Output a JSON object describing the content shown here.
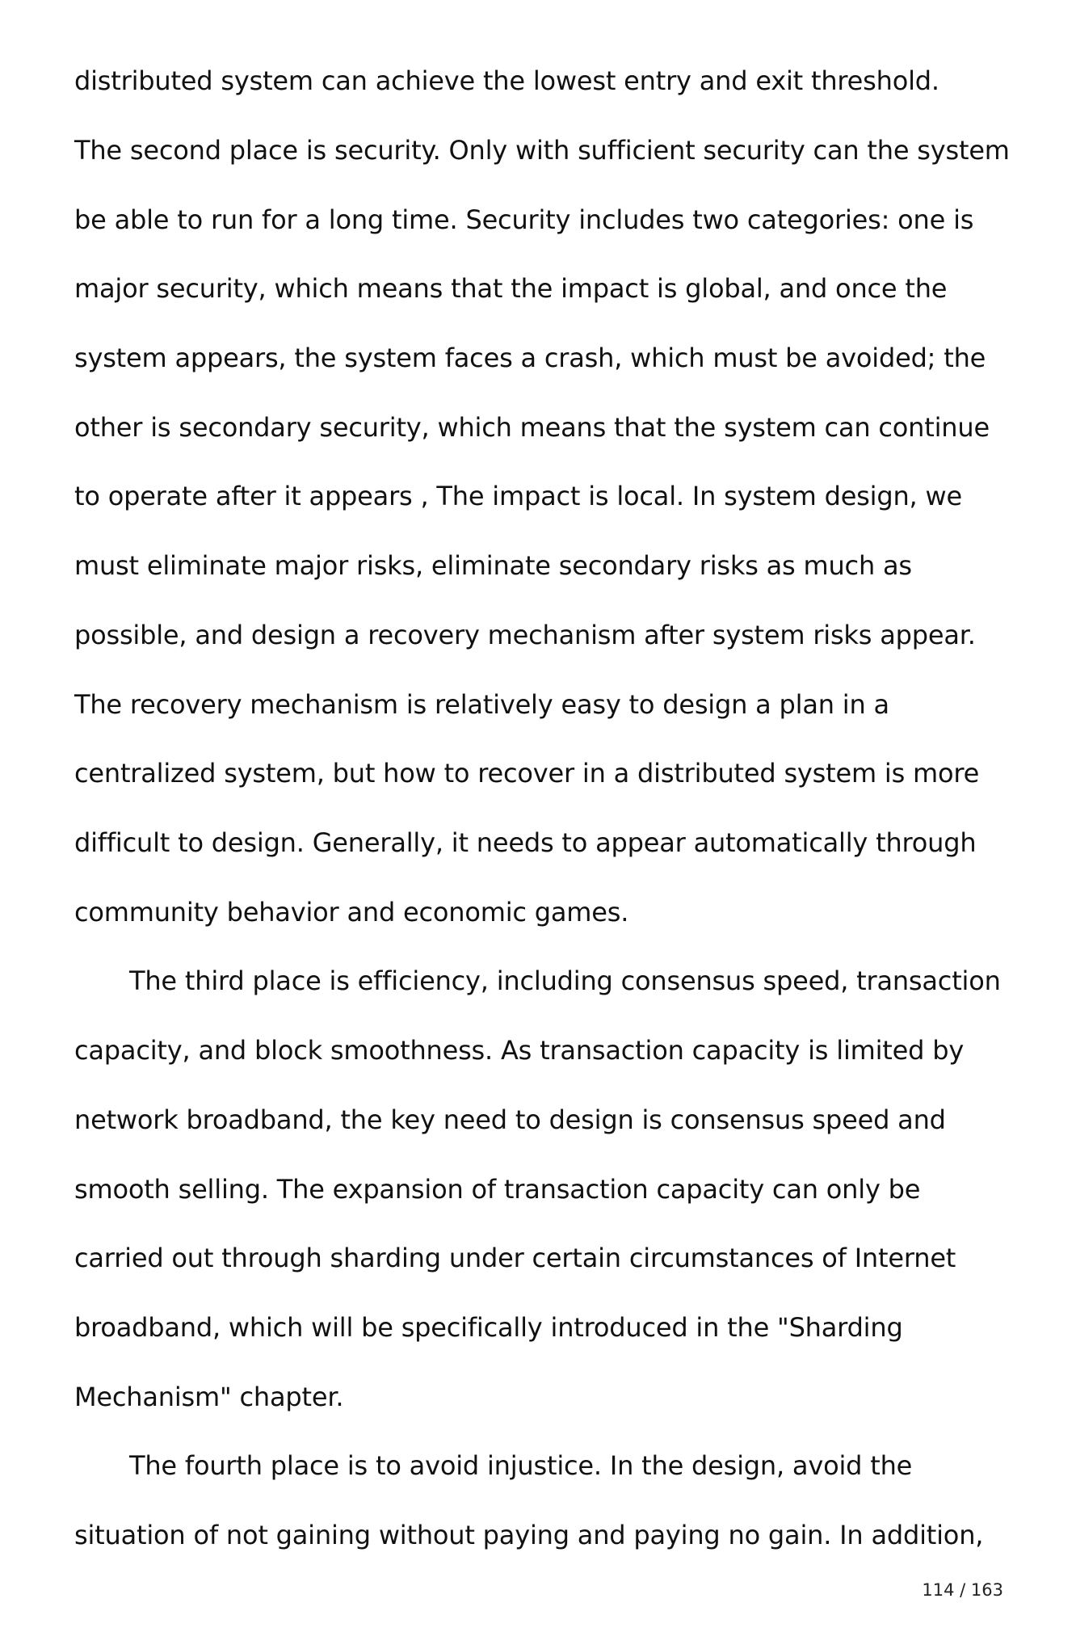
{
  "document": {
    "lines": [
      "distributed system can achieve the lowest entry and exit threshold.",
      "The second place is security. Only with sufficient security can the system",
      "be able to run for a long time. Security includes two categories: one is",
      "major security, which means that the impact is global, and once the",
      "system appears, the system faces a crash, which must be avoided; the",
      "other is secondary security, which means that the system can continue",
      "to operate after it appears , The impact is local. In system design, we",
      "must eliminate major risks, eliminate secondary risks as much as",
      "possible, and design a recovery mechanism after system risks appear.",
      "The recovery mechanism is relatively easy to design a plan in a",
      "centralized system, but how to recover in a distributed system is more",
      "difficult to design. Generally, it needs to appear automatically through",
      "community behavior and economic games.",
      "The third place is efficiency, including consensus speed, transaction",
      "capacity, and block smoothness. As transaction capacity is limited by",
      "network broadband, the key need to design is consensus speed and",
      "smooth selling. The expansion of transaction capacity can only be",
      "carried out through sharding under certain circumstances of Internet",
      "broadband, which will be specifically introduced in the \"Sharding",
      "Mechanism\" chapter.",
      "The fourth place is to avoid injustice. In the design, avoid the",
      "situation of not gaining without paying and paying no gain. In addition,"
    ]
  },
  "footer": {
    "page_number": "114 / 163"
  }
}
